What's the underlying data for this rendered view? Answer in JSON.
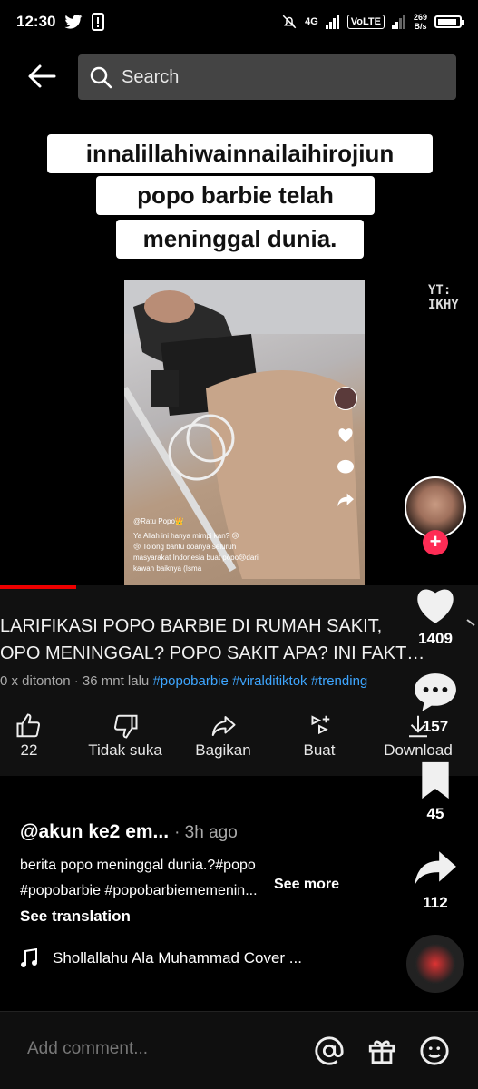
{
  "status_bar": {
    "time": "12:30",
    "network": "4G",
    "volte": "VoLTE",
    "speed_value": "269",
    "speed_unit": "B/s"
  },
  "search": {
    "placeholder": "Search"
  },
  "video": {
    "caption_lines": [
      "innalillahiwainnailaihirojiun",
      "popo barbie telah",
      "meninggal dunia."
    ],
    "watermark": "YT: IKHY",
    "frame_overlay": {
      "user": "@Ratu Popo👑",
      "line1": "Ya Allah ini hanya mimpi kan? 😢",
      "line2": "😢 Tolong bantu doanya seluruh",
      "line3": "masyarakat Indonesia buat popo😢dari",
      "line4": "kawan baiknya (Isma"
    }
  },
  "youtube": {
    "title_line1": "LARIFIKASI POPO BARBIE DI RUMAH SAKIT,",
    "title_line2": "OPO MENINGGAL? POPO SAKIT APA? INI FAKT…",
    "meta": "0 x ditonton · 36 mnt lalu",
    "tags": "#popobarbie #viralditiktok #trending",
    "actions": [
      {
        "label": "22"
      },
      {
        "label": "Tidak suka"
      },
      {
        "label": "Bagikan"
      },
      {
        "label": "Buat"
      },
      {
        "label": "Download"
      }
    ]
  },
  "rail": {
    "likes": "1409",
    "comments": "157",
    "saves": "45",
    "shares": "112"
  },
  "post": {
    "username": "@akun ke2 em...",
    "time_ago": "· 3h ago",
    "description_line1": "berita popo meninggal dunia.?#popo",
    "description_line2": "#popobarbie #popobarbiememenin...",
    "see_more": "See more",
    "see_translation": "See translation",
    "music": "Shollallahu Ala Muhammad Cover ..."
  },
  "comment_bar": {
    "placeholder": "Add comment..."
  },
  "colors": {
    "accent": "#fe2c55",
    "link": "#3ea6ff",
    "search_bg": "#444444"
  }
}
